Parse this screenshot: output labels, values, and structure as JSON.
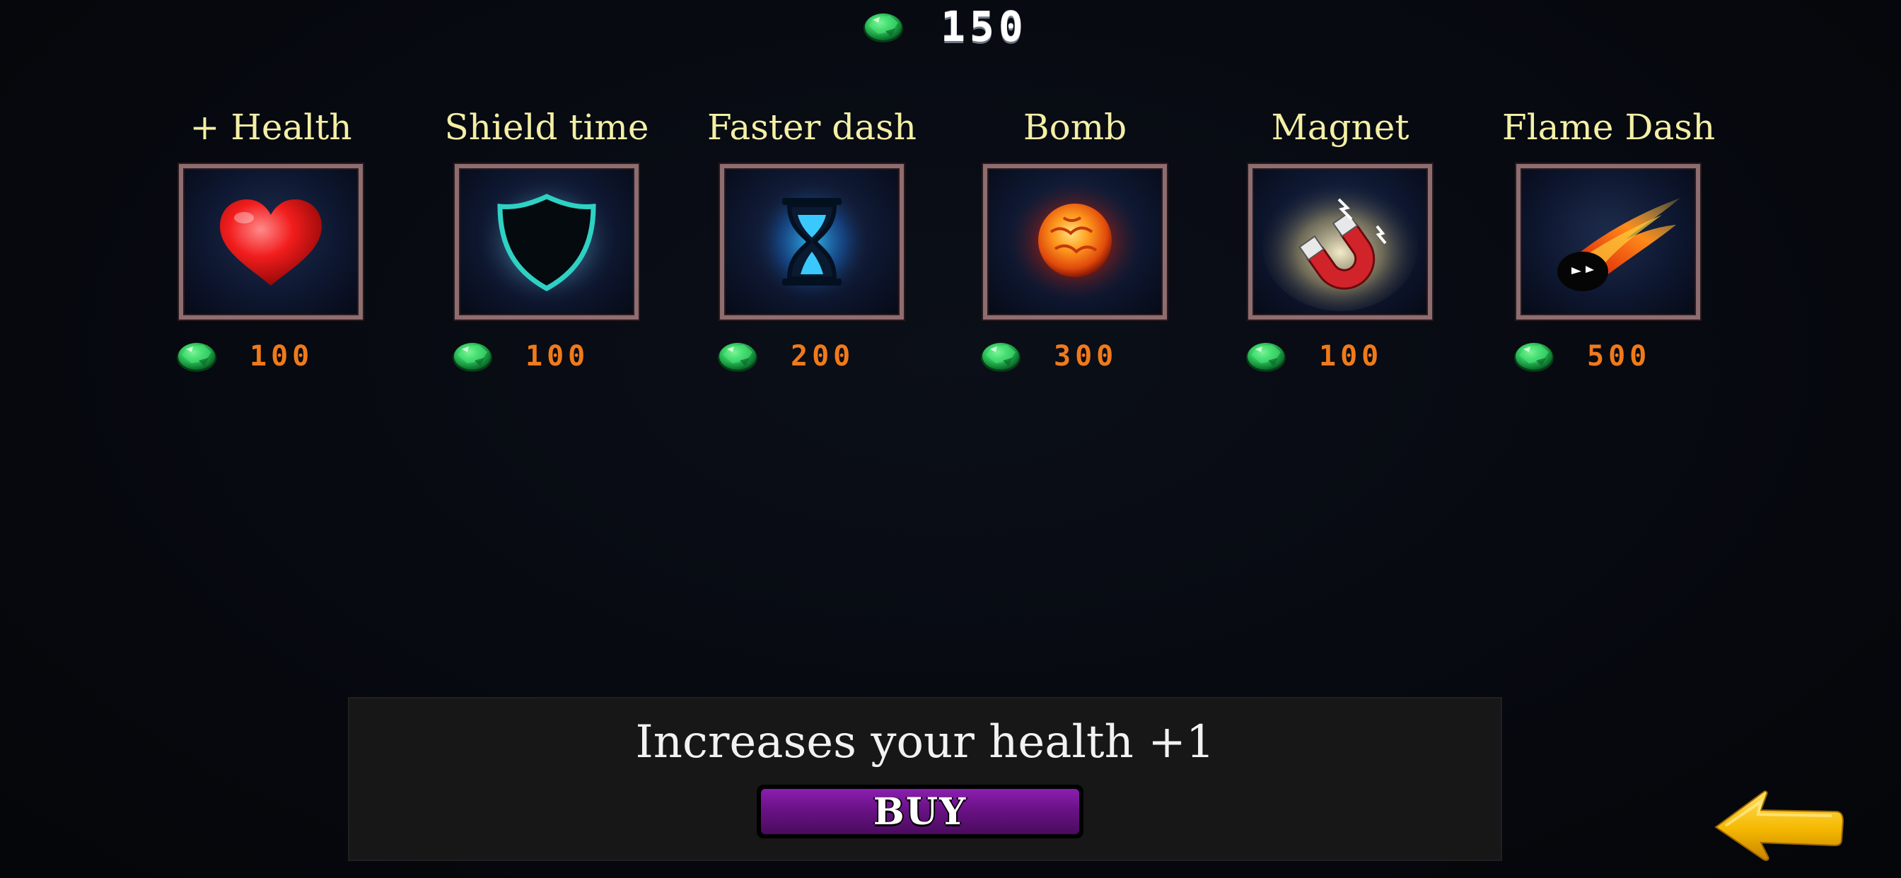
{
  "currency": {
    "icon": "emerald-gem-icon",
    "amount": "150"
  },
  "items": [
    {
      "title": "+ Health",
      "icon": "heart-icon",
      "cost": "100"
    },
    {
      "title": "Shield time",
      "icon": "shield-icon",
      "cost": "100"
    },
    {
      "title": "Faster dash",
      "icon": "hourglass-icon",
      "cost": "200"
    },
    {
      "title": "Bomb",
      "icon": "fireball-bomb-icon",
      "cost": "300"
    },
    {
      "title": "Magnet",
      "icon": "magnet-icon",
      "cost": "100"
    },
    {
      "title": "Flame Dash",
      "icon": "flaming-comet-icon",
      "cost": "500"
    }
  ],
  "description": {
    "text": "Increases your health +1",
    "buy_label": "BUY"
  },
  "back": {
    "icon": "back-arrow-icon"
  },
  "colors": {
    "title": "#f4efa5",
    "cost": "#f07a1a",
    "gem": "#21c45a",
    "frame": "#8e6d70",
    "buy": "#6a1286",
    "arrow": "#f5b800"
  }
}
